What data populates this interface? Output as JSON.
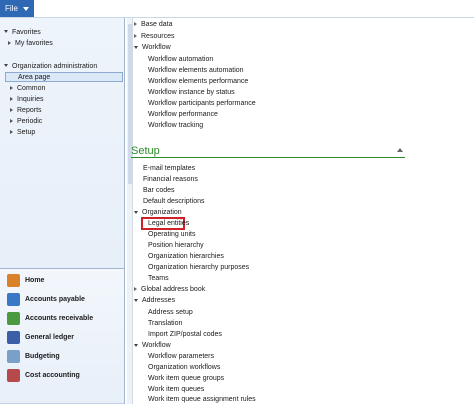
{
  "topbar": {
    "file_label": "File"
  },
  "nav": {
    "favorites_header": "Favorites",
    "favorites_items": [
      "My favorites"
    ],
    "org_header": "Organization administration",
    "org_items": [
      "Area page",
      "Common",
      "Inquiries",
      "Reports",
      "Periodic",
      "Setup"
    ]
  },
  "modules": [
    {
      "label": "Home",
      "color": "#d9822b"
    },
    {
      "label": "Accounts payable",
      "color": "#3a78c6"
    },
    {
      "label": "Accounts receivable",
      "color": "#4c9a3f"
    },
    {
      "label": "General ledger",
      "color": "#3a5fa8"
    },
    {
      "label": "Budgeting",
      "color": "#7a9fc9"
    },
    {
      "label": "Cost accounting",
      "color": "#b64a4a"
    }
  ],
  "content": {
    "top_groups": [
      {
        "label": "Base data",
        "expanded": false
      },
      {
        "label": "Resources",
        "expanded": false
      },
      {
        "label": "Workflow",
        "expanded": true
      }
    ],
    "workflow_items": [
      "Workflow automation",
      "Workflow elements automation",
      "Workflow elements performance",
      "Workflow instance by status",
      "Workflow participants performance",
      "Workflow performance",
      "Workflow tracking"
    ],
    "setup_title": "Setup",
    "setup_items": [
      "E-mail templates",
      "Financial reasons",
      "Bar codes",
      "Default descriptions"
    ],
    "organization_group": "Organization",
    "organization_items": [
      "Legal entities",
      "Operating units",
      "Position hierarchy",
      "Organization hierarchies",
      "Organization hierarchy purposes",
      "Teams"
    ],
    "global_address_book": "Global address book",
    "addresses_group": "Addresses",
    "addresses_items": [
      "Address setup",
      "Translation",
      "Import ZIP/postal codes"
    ],
    "workflow_group": "Workflow",
    "workflow_setup_items": [
      "Workflow parameters",
      "Organization workflows",
      "Work item queue groups",
      "Work item queues",
      "Work item queue assignment rules"
    ]
  }
}
